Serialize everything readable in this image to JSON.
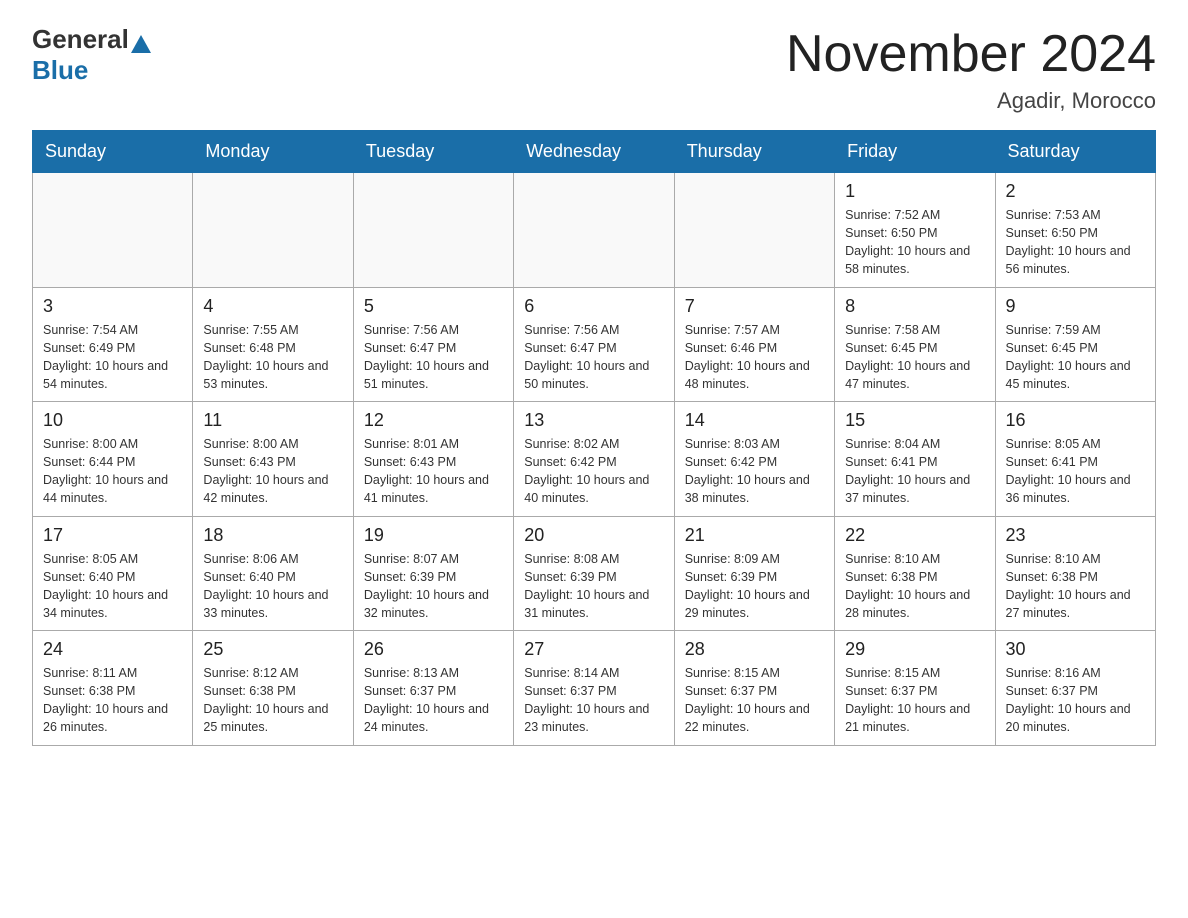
{
  "logo": {
    "general": "General",
    "blue": "Blue"
  },
  "header": {
    "month": "November 2024",
    "location": "Agadir, Morocco"
  },
  "weekdays": [
    "Sunday",
    "Monday",
    "Tuesday",
    "Wednesday",
    "Thursday",
    "Friday",
    "Saturday"
  ],
  "weeks": [
    [
      {
        "day": "",
        "info": ""
      },
      {
        "day": "",
        "info": ""
      },
      {
        "day": "",
        "info": ""
      },
      {
        "day": "",
        "info": ""
      },
      {
        "day": "",
        "info": ""
      },
      {
        "day": "1",
        "info": "Sunrise: 7:52 AM\nSunset: 6:50 PM\nDaylight: 10 hours and 58 minutes."
      },
      {
        "day": "2",
        "info": "Sunrise: 7:53 AM\nSunset: 6:50 PM\nDaylight: 10 hours and 56 minutes."
      }
    ],
    [
      {
        "day": "3",
        "info": "Sunrise: 7:54 AM\nSunset: 6:49 PM\nDaylight: 10 hours and 54 minutes."
      },
      {
        "day": "4",
        "info": "Sunrise: 7:55 AM\nSunset: 6:48 PM\nDaylight: 10 hours and 53 minutes."
      },
      {
        "day": "5",
        "info": "Sunrise: 7:56 AM\nSunset: 6:47 PM\nDaylight: 10 hours and 51 minutes."
      },
      {
        "day": "6",
        "info": "Sunrise: 7:56 AM\nSunset: 6:47 PM\nDaylight: 10 hours and 50 minutes."
      },
      {
        "day": "7",
        "info": "Sunrise: 7:57 AM\nSunset: 6:46 PM\nDaylight: 10 hours and 48 minutes."
      },
      {
        "day": "8",
        "info": "Sunrise: 7:58 AM\nSunset: 6:45 PM\nDaylight: 10 hours and 47 minutes."
      },
      {
        "day": "9",
        "info": "Sunrise: 7:59 AM\nSunset: 6:45 PM\nDaylight: 10 hours and 45 minutes."
      }
    ],
    [
      {
        "day": "10",
        "info": "Sunrise: 8:00 AM\nSunset: 6:44 PM\nDaylight: 10 hours and 44 minutes."
      },
      {
        "day": "11",
        "info": "Sunrise: 8:00 AM\nSunset: 6:43 PM\nDaylight: 10 hours and 42 minutes."
      },
      {
        "day": "12",
        "info": "Sunrise: 8:01 AM\nSunset: 6:43 PM\nDaylight: 10 hours and 41 minutes."
      },
      {
        "day": "13",
        "info": "Sunrise: 8:02 AM\nSunset: 6:42 PM\nDaylight: 10 hours and 40 minutes."
      },
      {
        "day": "14",
        "info": "Sunrise: 8:03 AM\nSunset: 6:42 PM\nDaylight: 10 hours and 38 minutes."
      },
      {
        "day": "15",
        "info": "Sunrise: 8:04 AM\nSunset: 6:41 PM\nDaylight: 10 hours and 37 minutes."
      },
      {
        "day": "16",
        "info": "Sunrise: 8:05 AM\nSunset: 6:41 PM\nDaylight: 10 hours and 36 minutes."
      }
    ],
    [
      {
        "day": "17",
        "info": "Sunrise: 8:05 AM\nSunset: 6:40 PM\nDaylight: 10 hours and 34 minutes."
      },
      {
        "day": "18",
        "info": "Sunrise: 8:06 AM\nSunset: 6:40 PM\nDaylight: 10 hours and 33 minutes."
      },
      {
        "day": "19",
        "info": "Sunrise: 8:07 AM\nSunset: 6:39 PM\nDaylight: 10 hours and 32 minutes."
      },
      {
        "day": "20",
        "info": "Sunrise: 8:08 AM\nSunset: 6:39 PM\nDaylight: 10 hours and 31 minutes."
      },
      {
        "day": "21",
        "info": "Sunrise: 8:09 AM\nSunset: 6:39 PM\nDaylight: 10 hours and 29 minutes."
      },
      {
        "day": "22",
        "info": "Sunrise: 8:10 AM\nSunset: 6:38 PM\nDaylight: 10 hours and 28 minutes."
      },
      {
        "day": "23",
        "info": "Sunrise: 8:10 AM\nSunset: 6:38 PM\nDaylight: 10 hours and 27 minutes."
      }
    ],
    [
      {
        "day": "24",
        "info": "Sunrise: 8:11 AM\nSunset: 6:38 PM\nDaylight: 10 hours and 26 minutes."
      },
      {
        "day": "25",
        "info": "Sunrise: 8:12 AM\nSunset: 6:38 PM\nDaylight: 10 hours and 25 minutes."
      },
      {
        "day": "26",
        "info": "Sunrise: 8:13 AM\nSunset: 6:37 PM\nDaylight: 10 hours and 24 minutes."
      },
      {
        "day": "27",
        "info": "Sunrise: 8:14 AM\nSunset: 6:37 PM\nDaylight: 10 hours and 23 minutes."
      },
      {
        "day": "28",
        "info": "Sunrise: 8:15 AM\nSunset: 6:37 PM\nDaylight: 10 hours and 22 minutes."
      },
      {
        "day": "29",
        "info": "Sunrise: 8:15 AM\nSunset: 6:37 PM\nDaylight: 10 hours and 21 minutes."
      },
      {
        "day": "30",
        "info": "Sunrise: 8:16 AM\nSunset: 6:37 PM\nDaylight: 10 hours and 20 minutes."
      }
    ]
  ]
}
